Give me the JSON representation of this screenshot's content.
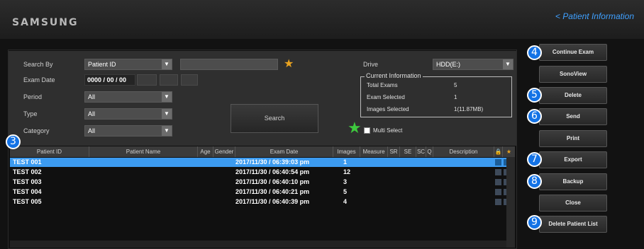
{
  "header": {
    "brand": "SAMSUNG",
    "title_link": "< Patient Information"
  },
  "search": {
    "search_by_label": "Search By",
    "search_by_value": "Patient ID",
    "exam_date_label": "Exam Date",
    "exam_date_value": "0000 / 00 / 00",
    "period_label": "Period",
    "period_value": "All",
    "type_label": "Type",
    "type_value": "All",
    "category_label": "Category",
    "category_value": "All",
    "search_button": "Search",
    "drive_label": "Drive",
    "drive_value": "HDD(E:)",
    "multi_select_label": "Multi Select",
    "multi_select_checked": false
  },
  "current_info": {
    "title": "Current Information",
    "rows": [
      {
        "label": "Total Exams",
        "value": "5"
      },
      {
        "label": "Exam Selected",
        "value": "1"
      },
      {
        "label": "Images Selected",
        "value": "1(11.87MB)"
      }
    ]
  },
  "table": {
    "columns": [
      "Patient ID",
      "Patient Name",
      "Age",
      "Gender",
      "Exam Date",
      "Images",
      "Measure",
      "SR",
      "SE",
      "SC",
      "Q",
      "Description"
    ],
    "rows": [
      {
        "id": "TEST 001",
        "name": "",
        "exam_date": "2017/11/30 / 06:39:03 pm",
        "images": "1",
        "selected": true
      },
      {
        "id": "TEST 002",
        "name": "",
        "exam_date": "2017/11/30 / 06:40:54 pm",
        "images": "12",
        "selected": false
      },
      {
        "id": "TEST 003",
        "name": "",
        "exam_date": "2017/11/30 / 06:40:10 pm",
        "images": "3",
        "selected": false
      },
      {
        "id": "TEST 004",
        "name": "",
        "exam_date": "2017/11/30 / 06:40:21 pm",
        "images": "5",
        "selected": false
      },
      {
        "id": "TEST 005",
        "name": "",
        "exam_date": "2017/11/30 / 06:40:39 pm",
        "images": "4",
        "selected": false
      }
    ]
  },
  "sidebar": {
    "buttons": [
      "Continue Exam",
      "SonoView",
      "Delete",
      "Send",
      "Print",
      "Export",
      "Backup",
      "Close",
      "Delete Patient List"
    ]
  },
  "callouts": [
    "3",
    "4",
    "5",
    "6",
    "7",
    "8",
    "9"
  ],
  "colors": {
    "accent": "#3c9bf0",
    "badge": "#1473e6",
    "header_link": "#3fa0ff",
    "star": "#e9a320",
    "green_star": "#3ec93e"
  }
}
